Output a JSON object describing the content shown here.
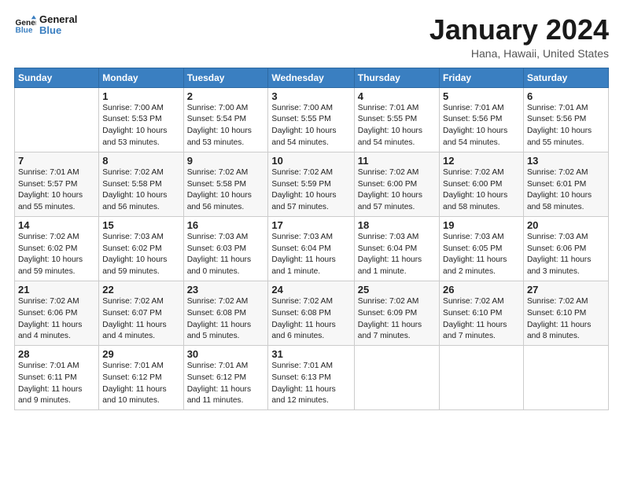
{
  "header": {
    "logo_line1": "General",
    "logo_line2": "Blue",
    "title": "January 2024",
    "subtitle": "Hana, Hawaii, United States"
  },
  "days_of_week": [
    "Sunday",
    "Monday",
    "Tuesday",
    "Wednesday",
    "Thursday",
    "Friday",
    "Saturday"
  ],
  "weeks": [
    [
      {
        "num": "",
        "info": ""
      },
      {
        "num": "1",
        "info": "Sunrise: 7:00 AM\nSunset: 5:53 PM\nDaylight: 10 hours\nand 53 minutes."
      },
      {
        "num": "2",
        "info": "Sunrise: 7:00 AM\nSunset: 5:54 PM\nDaylight: 10 hours\nand 53 minutes."
      },
      {
        "num": "3",
        "info": "Sunrise: 7:00 AM\nSunset: 5:55 PM\nDaylight: 10 hours\nand 54 minutes."
      },
      {
        "num": "4",
        "info": "Sunrise: 7:01 AM\nSunset: 5:55 PM\nDaylight: 10 hours\nand 54 minutes."
      },
      {
        "num": "5",
        "info": "Sunrise: 7:01 AM\nSunset: 5:56 PM\nDaylight: 10 hours\nand 54 minutes."
      },
      {
        "num": "6",
        "info": "Sunrise: 7:01 AM\nSunset: 5:56 PM\nDaylight: 10 hours\nand 55 minutes."
      }
    ],
    [
      {
        "num": "7",
        "info": "Sunrise: 7:01 AM\nSunset: 5:57 PM\nDaylight: 10 hours\nand 55 minutes."
      },
      {
        "num": "8",
        "info": "Sunrise: 7:02 AM\nSunset: 5:58 PM\nDaylight: 10 hours\nand 56 minutes."
      },
      {
        "num": "9",
        "info": "Sunrise: 7:02 AM\nSunset: 5:58 PM\nDaylight: 10 hours\nand 56 minutes."
      },
      {
        "num": "10",
        "info": "Sunrise: 7:02 AM\nSunset: 5:59 PM\nDaylight: 10 hours\nand 57 minutes."
      },
      {
        "num": "11",
        "info": "Sunrise: 7:02 AM\nSunset: 6:00 PM\nDaylight: 10 hours\nand 57 minutes."
      },
      {
        "num": "12",
        "info": "Sunrise: 7:02 AM\nSunset: 6:00 PM\nDaylight: 10 hours\nand 58 minutes."
      },
      {
        "num": "13",
        "info": "Sunrise: 7:02 AM\nSunset: 6:01 PM\nDaylight: 10 hours\nand 58 minutes."
      }
    ],
    [
      {
        "num": "14",
        "info": "Sunrise: 7:02 AM\nSunset: 6:02 PM\nDaylight: 10 hours\nand 59 minutes."
      },
      {
        "num": "15",
        "info": "Sunrise: 7:03 AM\nSunset: 6:02 PM\nDaylight: 10 hours\nand 59 minutes."
      },
      {
        "num": "16",
        "info": "Sunrise: 7:03 AM\nSunset: 6:03 PM\nDaylight: 11 hours\nand 0 minutes."
      },
      {
        "num": "17",
        "info": "Sunrise: 7:03 AM\nSunset: 6:04 PM\nDaylight: 11 hours\nand 1 minute."
      },
      {
        "num": "18",
        "info": "Sunrise: 7:03 AM\nSunset: 6:04 PM\nDaylight: 11 hours\nand 1 minute."
      },
      {
        "num": "19",
        "info": "Sunrise: 7:03 AM\nSunset: 6:05 PM\nDaylight: 11 hours\nand 2 minutes."
      },
      {
        "num": "20",
        "info": "Sunrise: 7:03 AM\nSunset: 6:06 PM\nDaylight: 11 hours\nand 3 minutes."
      }
    ],
    [
      {
        "num": "21",
        "info": "Sunrise: 7:02 AM\nSunset: 6:06 PM\nDaylight: 11 hours\nand 4 minutes."
      },
      {
        "num": "22",
        "info": "Sunrise: 7:02 AM\nSunset: 6:07 PM\nDaylight: 11 hours\nand 4 minutes."
      },
      {
        "num": "23",
        "info": "Sunrise: 7:02 AM\nSunset: 6:08 PM\nDaylight: 11 hours\nand 5 minutes."
      },
      {
        "num": "24",
        "info": "Sunrise: 7:02 AM\nSunset: 6:08 PM\nDaylight: 11 hours\nand 6 minutes."
      },
      {
        "num": "25",
        "info": "Sunrise: 7:02 AM\nSunset: 6:09 PM\nDaylight: 11 hours\nand 7 minutes."
      },
      {
        "num": "26",
        "info": "Sunrise: 7:02 AM\nSunset: 6:10 PM\nDaylight: 11 hours\nand 7 minutes."
      },
      {
        "num": "27",
        "info": "Sunrise: 7:02 AM\nSunset: 6:10 PM\nDaylight: 11 hours\nand 8 minutes."
      }
    ],
    [
      {
        "num": "28",
        "info": "Sunrise: 7:01 AM\nSunset: 6:11 PM\nDaylight: 11 hours\nand 9 minutes."
      },
      {
        "num": "29",
        "info": "Sunrise: 7:01 AM\nSunset: 6:12 PM\nDaylight: 11 hours\nand 10 minutes."
      },
      {
        "num": "30",
        "info": "Sunrise: 7:01 AM\nSunset: 6:12 PM\nDaylight: 11 hours\nand 11 minutes."
      },
      {
        "num": "31",
        "info": "Sunrise: 7:01 AM\nSunset: 6:13 PM\nDaylight: 11 hours\nand 12 minutes."
      },
      {
        "num": "",
        "info": ""
      },
      {
        "num": "",
        "info": ""
      },
      {
        "num": "",
        "info": ""
      }
    ]
  ]
}
